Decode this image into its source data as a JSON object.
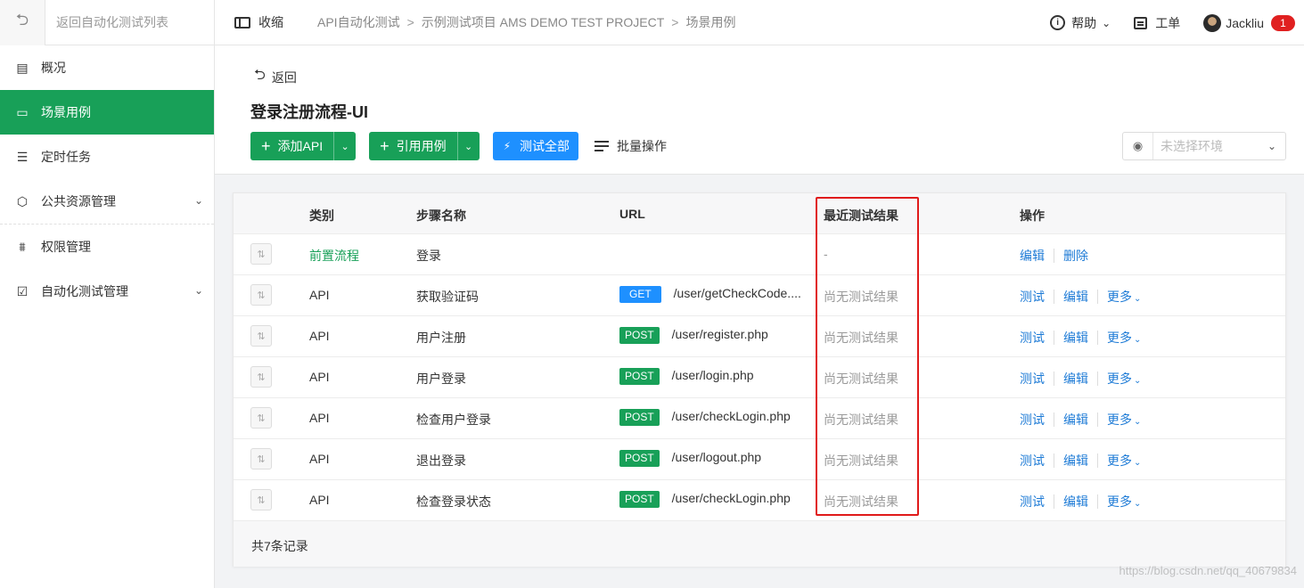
{
  "sidebar": {
    "back_label": "返回自动化测试列表",
    "items": [
      {
        "label": "概况",
        "icon": "overview-icon",
        "active": false
      },
      {
        "label": "场景用例",
        "icon": "robot-icon",
        "active": true
      },
      {
        "label": "定时任务",
        "icon": "list-icon",
        "active": false
      },
      {
        "label": "公共资源管理",
        "icon": "cube-icon",
        "active": false,
        "expandable": true
      },
      {
        "label": "权限管理",
        "icon": "org-icon",
        "active": false
      },
      {
        "label": "自动化测试管理",
        "icon": "clipboard-icon",
        "active": false,
        "expandable": true
      }
    ]
  },
  "header": {
    "collapse_label": "收缩",
    "breadcrumbs": [
      "API自动化测试",
      "示例测试项目 AMS DEMO TEST PROJECT",
      "场景用例"
    ],
    "breadcrumb_sep": ">",
    "help_label": "帮助",
    "ticket_label": "工单",
    "user_name": "Jackliu",
    "notification_count": "1"
  },
  "page": {
    "back_label": "返回",
    "title": "登录注册流程-UI",
    "add_api_label": "添加API",
    "ref_case_label": "引用用例",
    "test_all_label": "测试全部",
    "batch_label": "批量操作",
    "env_placeholder": "未选择环境"
  },
  "table": {
    "columns": [
      "类别",
      "步骤名称",
      "URL",
      "最近测试结果",
      "操作"
    ],
    "rows": [
      {
        "category": "前置流程",
        "name": "登录",
        "method": "",
        "url": "",
        "result": "-",
        "ops": [
          "编辑",
          "删除"
        ]
      },
      {
        "category": "API",
        "name": "获取验证码",
        "method": "GET",
        "url": "/user/getCheckCode....",
        "result": "尚无测试结果",
        "ops": [
          "测试",
          "编辑",
          "更多"
        ]
      },
      {
        "category": "API",
        "name": "用户注册",
        "method": "POST",
        "url": "/user/register.php",
        "result": "尚无测试结果",
        "ops": [
          "测试",
          "编辑",
          "更多"
        ]
      },
      {
        "category": "API",
        "name": "用户登录",
        "method": "POST",
        "url": "/user/login.php",
        "result": "尚无测试结果",
        "ops": [
          "测试",
          "编辑",
          "更多"
        ]
      },
      {
        "category": "API",
        "name": "检查用户登录",
        "method": "POST",
        "url": "/user/checkLogin.php",
        "result": "尚无测试结果",
        "ops": [
          "测试",
          "编辑",
          "更多"
        ]
      },
      {
        "category": "API",
        "name": "退出登录",
        "method": "POST",
        "url": "/user/logout.php",
        "result": "尚无测试结果",
        "ops": [
          "测试",
          "编辑",
          "更多"
        ]
      },
      {
        "category": "API",
        "name": "检查登录状态",
        "method": "POST",
        "url": "/user/checkLogin.php",
        "result": "尚无测试结果",
        "ops": [
          "测试",
          "编辑",
          "更多"
        ]
      }
    ],
    "total_label": "共7条记录"
  },
  "watermark": "https://blog.csdn.net/qq_40679834",
  "colors": {
    "accent": "#18a058",
    "blue": "#1e90ff",
    "link": "#1e7bd6",
    "highlight": "#e01b1b"
  }
}
